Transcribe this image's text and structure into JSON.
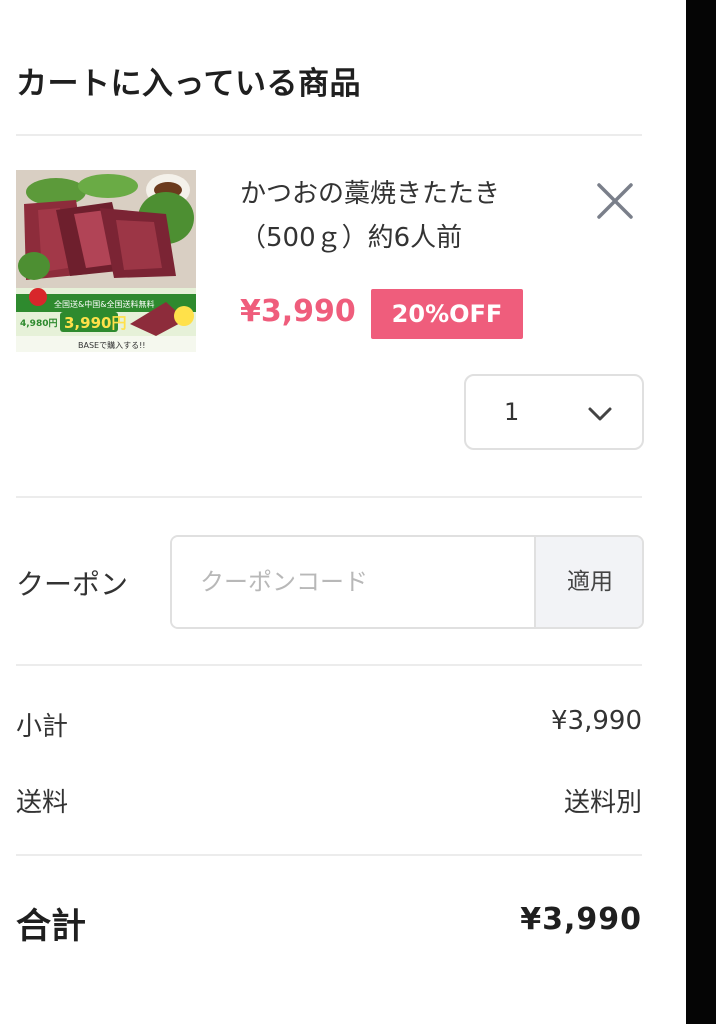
{
  "cart": {
    "title": "カートに入っている商品"
  },
  "item": {
    "name_line1": "かつおの藁焼きたたき",
    "name_line2": "（500ｇ）約6人前",
    "price": "¥3,990",
    "discount_badge": "20%OFF",
    "quantity": "1",
    "remove_icon": "close-icon",
    "quantity_icon": "chevron-down-icon",
    "image_text": {
      "banner_top": "全国送&中国&全国送料無料",
      "old_price": "4,980円",
      "new_price": "3,990円",
      "footer": "BASEで購入する!!"
    }
  },
  "coupon": {
    "label": "クーポン",
    "placeholder": "クーポンコード",
    "apply_label": "適用"
  },
  "summary": {
    "subtotal_label": "小計",
    "subtotal_value": "¥3,990",
    "shipping_label": "送料",
    "shipping_value": "送料別",
    "total_label": "合計",
    "total_value": "¥3,990"
  },
  "colors": {
    "accent": "#ef5d7c",
    "divider": "#ececec",
    "border": "#e0e0e0",
    "button_bg": "#f2f3f6"
  }
}
